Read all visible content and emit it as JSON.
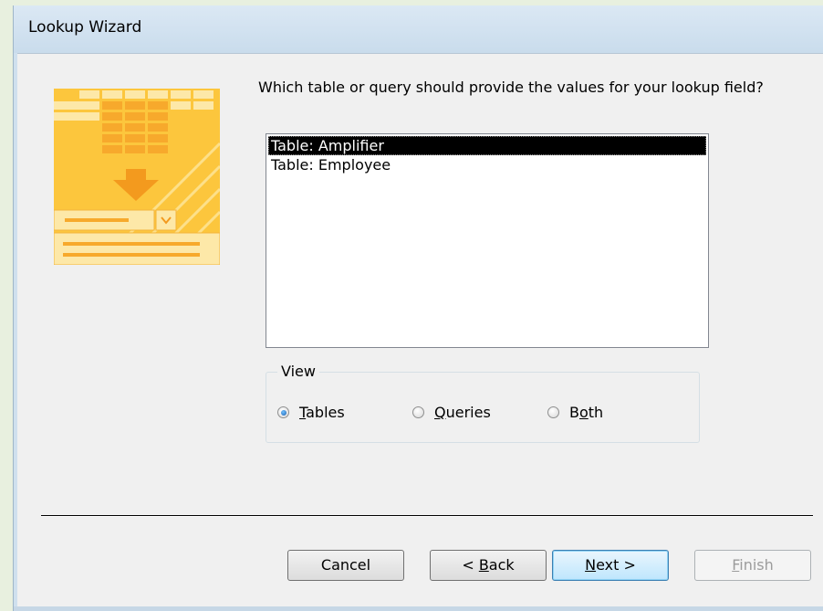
{
  "window": {
    "title": "Lookup Wizard"
  },
  "prompt": "Which table or query should provide the values for your lookup field?",
  "list": {
    "items": [
      "Table: Amplifier",
      "Table: Employee"
    ],
    "selected_index": 0
  },
  "view_group": {
    "legend": "View",
    "options": [
      {
        "label": "Tables",
        "mnemonic": "T",
        "rest": "ables",
        "checked": true
      },
      {
        "label": "Queries",
        "mnemonic": "Q",
        "rest": "ueries",
        "checked": false
      },
      {
        "label": "Both",
        "pre": "B",
        "mnemonic": "o",
        "rest": "th",
        "checked": false
      }
    ]
  },
  "buttons": {
    "cancel": "Cancel",
    "back": {
      "prefix": "< ",
      "mnemonic": "B",
      "rest": "ack"
    },
    "next": {
      "mnemonic": "N",
      "rest": "ext >"
    },
    "finish": {
      "mnemonic": "F",
      "rest": "inish",
      "enabled": false
    }
  },
  "colors": {
    "illustration": "#fcc63d",
    "selection": "#000000",
    "arrow": "#f39a1e"
  },
  "icons": {
    "illustration": "lookup-wizard-illustration-icon"
  }
}
